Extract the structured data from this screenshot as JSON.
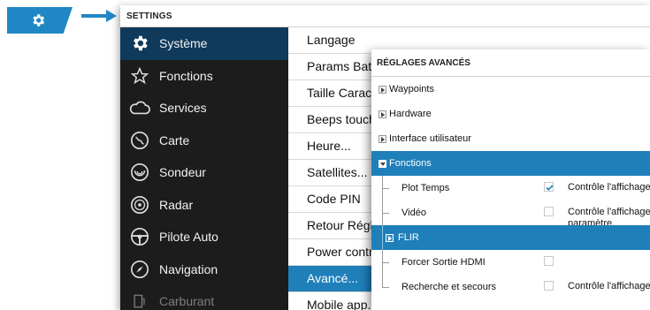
{
  "settings": {
    "title": "SETTINGS",
    "sidebar": [
      {
        "label": "Système",
        "icon": "gear-icon"
      },
      {
        "label": "Fonctions",
        "icon": "star-icon"
      },
      {
        "label": "Services",
        "icon": "cloud-icon"
      },
      {
        "label": "Carte",
        "icon": "chart-icon"
      },
      {
        "label": "Sondeur",
        "icon": "sonar-icon"
      },
      {
        "label": "Radar",
        "icon": "radar-icon"
      },
      {
        "label": "Pilote Auto",
        "icon": "steering-wheel-icon"
      },
      {
        "label": "Navigation",
        "icon": "compass-icon"
      },
      {
        "label": "Carburant",
        "icon": "fuel-icon"
      }
    ],
    "menu": [
      "Langage",
      "Params Bateau",
      "Taille Caractères",
      "Beeps touches",
      "Heure...",
      "Satellites...",
      "Code PIN",
      "Retour Réglages",
      "Power control",
      "Avancé...",
      "Mobile app..."
    ]
  },
  "advanced": {
    "title": "RÉGLAGES AVANCÉS",
    "rows": [
      {
        "label": "Waypoints"
      },
      {
        "label": "Hardware"
      },
      {
        "label": "Interface utilisateur"
      },
      {
        "label": "Fonctions"
      },
      {
        "label": "Plot Temps",
        "desc": "Contrôle l'affichage de"
      },
      {
        "label": "Vidéo",
        "desc": "Contrôle l'affichage de",
        "desc2": "paramètre."
      },
      {
        "label": "FLIR"
      },
      {
        "label": "Forcer Sortie HDMI"
      },
      {
        "label": "Recherche et secours",
        "desc": "Contrôle l'affichage de"
      }
    ]
  },
  "colors": {
    "accent": "#1f87c4",
    "sidebar_bg": "#1c1c1c",
    "selection": "#1f7fb9"
  }
}
